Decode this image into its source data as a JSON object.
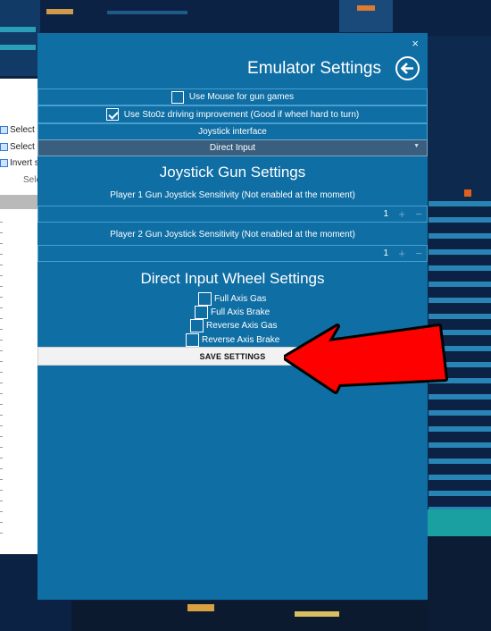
{
  "ribbon": {
    "items": [
      "Select a",
      "Select ",
      "Invert s"
    ],
    "group_label": "Sele"
  },
  "panel": {
    "close_glyph": "×",
    "title": "Emulator Settings",
    "options": {
      "use_mouse_label": "Use Mouse for gun games",
      "use_mouse_checked": false,
      "sto0z_label": "Use Sto0z driving improvement (Good if wheel hard to turn)",
      "sto0z_checked": true
    },
    "joystick_interface": {
      "label": "Joystick interface",
      "selected": "Direct Input"
    },
    "gun_settings": {
      "title": "Joystick Gun Settings",
      "player1_label": "Player 1 Gun Joystick Sensitivity (Not enabled at the moment)",
      "player1_value": "1",
      "player2_label": "Player 2 Gun Joystick Sensitivity (Not enabled at the moment)",
      "player2_value": "1"
    },
    "wheel_settings": {
      "title": "Direct Input Wheel Settings",
      "options": [
        {
          "label": "Full Axis Gas",
          "checked": false
        },
        {
          "label": "Full Axis Brake",
          "checked": false
        },
        {
          "label": "Reverse Axis Gas",
          "checked": false
        },
        {
          "label": "Reverse Axis Brake",
          "checked": false
        }
      ]
    },
    "save_label": "SAVE SETTINGS"
  },
  "colors": {
    "panel_bg": "#0f6ea4",
    "arrow_red": "#ff0000",
    "game_bg": "#0a1e3c"
  },
  "icons": {
    "back": "back-arrow-circle-icon",
    "close": "close-icon",
    "dropdown": "chevron-down-icon",
    "annotation": "red-arrow-icon"
  }
}
